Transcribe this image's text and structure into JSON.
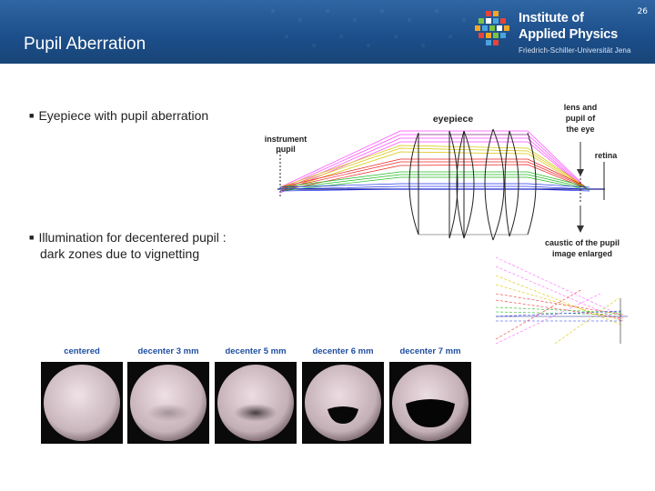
{
  "header": {
    "title": "Pupil Aberration",
    "page_number": "26",
    "logo": {
      "line1": "Institute of",
      "line2": "Applied Physics",
      "line3": "Friedrich-Schiller-Universität Jena"
    }
  },
  "bullets": [
    {
      "text": "Eyepiece with pupil aberration"
    },
    {
      "text": "Illumination for decentered pupil :",
      "continuation": "dark zones due to vignetting"
    }
  ],
  "diagram": {
    "labels": {
      "eyepiece": "eyepiece",
      "instrument_pupil_1": "instrument",
      "instrument_pupil_2": "pupil",
      "lens_1": "lens and",
      "lens_2": "pupil of",
      "lens_3": "the eye",
      "retina": "retina",
      "caustic_1": "caustic of the pupil",
      "caustic_2": "image enlarged"
    }
  },
  "pupil_images": [
    {
      "caption": "centered",
      "decenter": 0
    },
    {
      "caption": "decenter 3 mm",
      "decenter": 3
    },
    {
      "caption": "decenter 5 mm",
      "decenter": 5
    },
    {
      "caption": "decenter 6 mm",
      "decenter": 6
    },
    {
      "caption": "decenter 7 mm",
      "decenter": 7
    }
  ],
  "colors": {
    "header": "#1d4f8b",
    "caption": "#1f4fa0",
    "ray_colors": [
      "#ff44ff",
      "#d7c400",
      "#ee2222",
      "#22bb22",
      "#2233ee"
    ]
  }
}
